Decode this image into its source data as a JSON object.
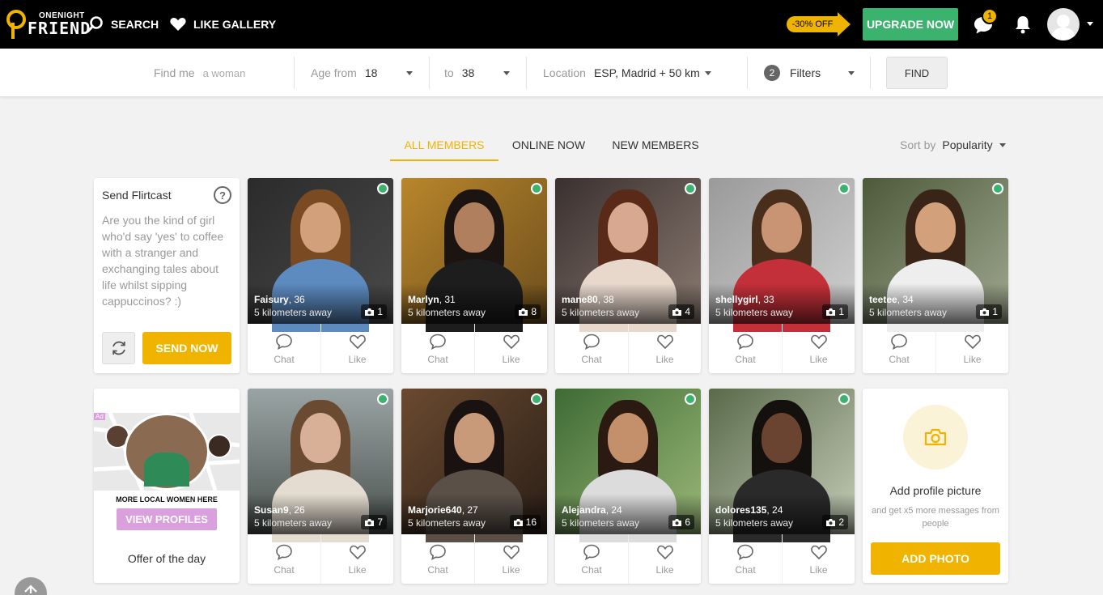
{
  "header": {
    "logo_top": "ONENIGHT",
    "logo_bottom": "FRIEND",
    "search_label": "SEARCH",
    "like_gallery_label": "LIKE GALLERY",
    "discount": "-30% OFF",
    "upgrade_label": "UPGRADE NOW",
    "message_count": "1"
  },
  "filters": {
    "find_me_label": "Find me",
    "find_me_value": "a woman",
    "age_from_label": "Age from",
    "age_from_value": "18",
    "age_to_label": "to",
    "age_to_value": "38",
    "location_label": "Location",
    "location_value": "ESP, Madrid + 50 km",
    "filters_count": "2",
    "filters_label": "Filters",
    "find_label": "FIND"
  },
  "tabs": [
    {
      "label": "ALL MEMBERS",
      "active": true
    },
    {
      "label": "ONLINE NOW",
      "active": false
    },
    {
      "label": "NEW MEMBERS",
      "active": false
    }
  ],
  "sort": {
    "label": "Sort by",
    "value": "Popularity"
  },
  "flirtcast": {
    "title": "Send Flirtcast",
    "help": "?",
    "text": "Are you the kind of girl who'd say 'yes' to coffee with a stranger and exchanging tales about life whilst sipping cappuccinos? :)",
    "send_label": "SEND NOW"
  },
  "offer": {
    "ad_tag": "Ad",
    "headline": "MORE LOCAL WOMEN HERE",
    "button": "VIEW PROFILES",
    "caption": "Offer of the day"
  },
  "add_photo": {
    "title": "Add profile picture",
    "subtitle": "and get x5 more messages from people",
    "button": "ADD PHOTO"
  },
  "action_labels": {
    "chat": "Chat",
    "like": "Like"
  },
  "members": [
    {
      "name": "Faisury",
      "age": ", 36",
      "distance": "5 kilometers away",
      "photos": "1",
      "online": true
    },
    {
      "name": "Marlyn",
      "age": ", 31",
      "distance": "5 kilometers away",
      "photos": "8",
      "online": true
    },
    {
      "name": "mane80",
      "age": ", 38",
      "distance": "5 kilometers away",
      "photos": "4",
      "online": true
    },
    {
      "name": "shellygirl",
      "age": ", 33",
      "distance": "5 kilometers away",
      "photos": "1",
      "online": true
    },
    {
      "name": "teetee",
      "age": ", 34",
      "distance": "5 kilometers away",
      "photos": "1",
      "online": true
    },
    {
      "name": "Susan9",
      "age": ", 26",
      "distance": "5 kilometers away",
      "photos": "7",
      "online": true
    },
    {
      "name": "Marjorie640",
      "age": ", 27",
      "distance": "5 kilometers away",
      "photos": "16",
      "online": true
    },
    {
      "name": "Alejandra",
      "age": ", 24",
      "distance": "5 kilometers away",
      "photos": "6",
      "online": true
    },
    {
      "name": "dolores135",
      "age": ", 24",
      "distance": "5 kilometers away",
      "photos": "2",
      "online": true
    }
  ],
  "colors": {
    "accent": "#f0b400",
    "upgrade": "#3bb36e",
    "online": "#3bb36e",
    "ad_button": "#d9a0dd"
  }
}
